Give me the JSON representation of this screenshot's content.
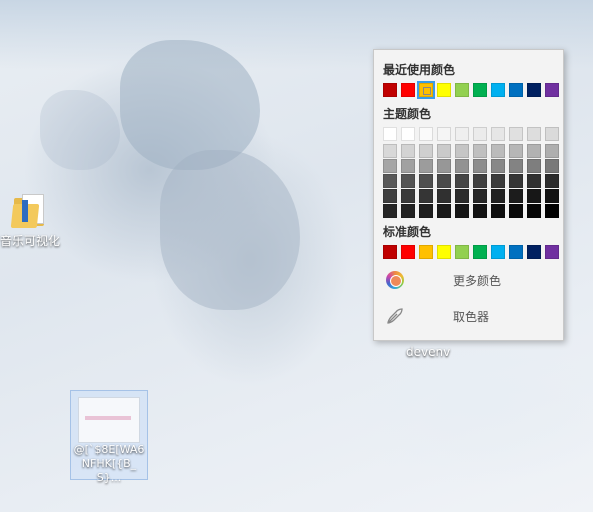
{
  "desktop": {
    "icons": [
      {
        "label": "音乐可视化"
      },
      {
        "label": "@[`$8E[WA6NFHK[{B_S}..."
      }
    ],
    "devenv_label": "devenv"
  },
  "palette": {
    "recent_title": "最近使用颜色",
    "recent_colors": [
      "#C00000",
      "#FF0000",
      "#FFC000",
      "#FFFF00",
      "#92D050",
      "#00B050",
      "#00B0F0",
      "#0070C0",
      "#002060",
      "#7030A0"
    ],
    "recent_selected_index": 2,
    "theme_title": "主题颜色",
    "theme_colors": [
      [
        "#FFFFFF",
        "#FFFFFF",
        "#FAFAFA",
        "#F5F5F5",
        "#EFEFEF",
        "#EBEBEB",
        "#E6E6E6",
        "#E0E0E0",
        "#DDDDDD",
        "#DADADA"
      ],
      [
        "#D8D8D8",
        "#D3D3D3",
        "#CFCFCF",
        "#CACACA",
        "#C5C5C5",
        "#C0C0C0",
        "#BBBBBB",
        "#B6B6B6",
        "#B2B2B2",
        "#AEAEAE"
      ],
      [
        "#A6A6A6",
        "#A1A1A1",
        "#9C9C9C",
        "#979797",
        "#929292",
        "#8D8D8D",
        "#888888",
        "#838383",
        "#7E7E7E",
        "#797979"
      ],
      [
        "#595959",
        "#545454",
        "#4F4F4F",
        "#4A4A4A",
        "#454545",
        "#404040",
        "#3B3B3B",
        "#363636",
        "#313131",
        "#2C2C2C"
      ],
      [
        "#3F3F3F",
        "#3A3A3A",
        "#353535",
        "#303030",
        "#2B2B2B",
        "#262626",
        "#212121",
        "#1C1C1C",
        "#171717",
        "#121212"
      ],
      [
        "#262626",
        "#222222",
        "#1E1E1E",
        "#1A1A1A",
        "#161616",
        "#121212",
        "#0E0E0E",
        "#0A0A0A",
        "#060606",
        "#000000"
      ]
    ],
    "standard_title": "标准颜色",
    "standard_colors": [
      "#C00000",
      "#FF0000",
      "#FFC000",
      "#FFFF00",
      "#92D050",
      "#00B050",
      "#00B0F0",
      "#0070C0",
      "#002060",
      "#7030A0"
    ],
    "more_colors_label": "更多颜色",
    "eyedropper_label": "取色器",
    "more_colors_icon": "color-wheel-icon",
    "eyedropper_icon": "eyedropper-icon"
  }
}
